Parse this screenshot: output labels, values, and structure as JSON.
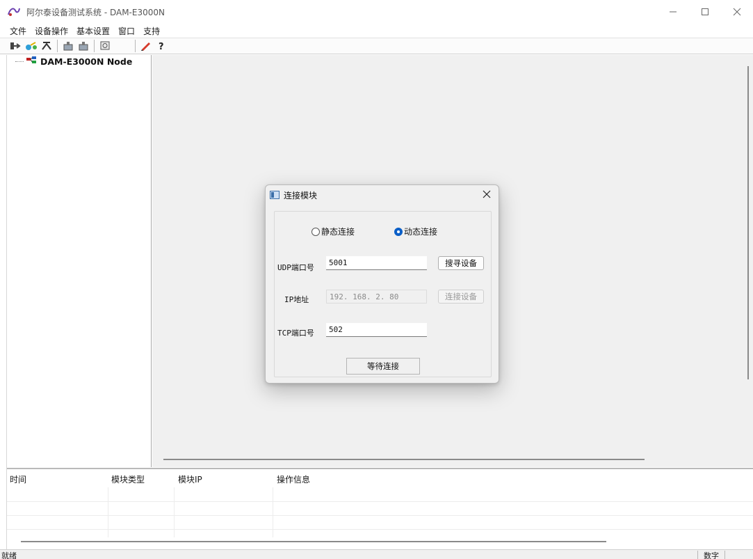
{
  "window": {
    "title": "阿尔泰设备测试系统 - DAM-E3000N",
    "icon": "app-icon",
    "controls": [
      "minimize",
      "maximize",
      "close"
    ]
  },
  "menu": [
    "文件",
    "设备操作",
    "基本设置",
    "窗口",
    "支持"
  ],
  "toolbar": {
    "icons": [
      "connect-icon",
      "network-icon",
      "disconnect-icon",
      "module-config-icon",
      "module-config-2-icon",
      "monitor-icon",
      "pen-icon",
      "help-icon"
    ]
  },
  "tree": {
    "node_label": "DAM-E3000N Node"
  },
  "dialog": {
    "title": "连接模块",
    "radio_static": "静态连接",
    "radio_dynamic": "动态连接",
    "selected_mode": "动态连接",
    "udp_label": "UDP端口号",
    "udp_value": "5001",
    "search_button": "搜寻设备",
    "ip_label": "IP地址",
    "ip_value": "192. 168. 2. 80",
    "connect_button": "连接设备",
    "tcp_label": "TCP端口号",
    "tcp_value": "502",
    "wait_button": "等待连接"
  },
  "log": {
    "columns": [
      "时间",
      "模块类型",
      "模块IP",
      "操作信息"
    ]
  },
  "status": {
    "text": "就绪",
    "num": "数字"
  },
  "colors": {
    "accent": "#0b5fc7",
    "workspace": "#f0f0f0"
  }
}
